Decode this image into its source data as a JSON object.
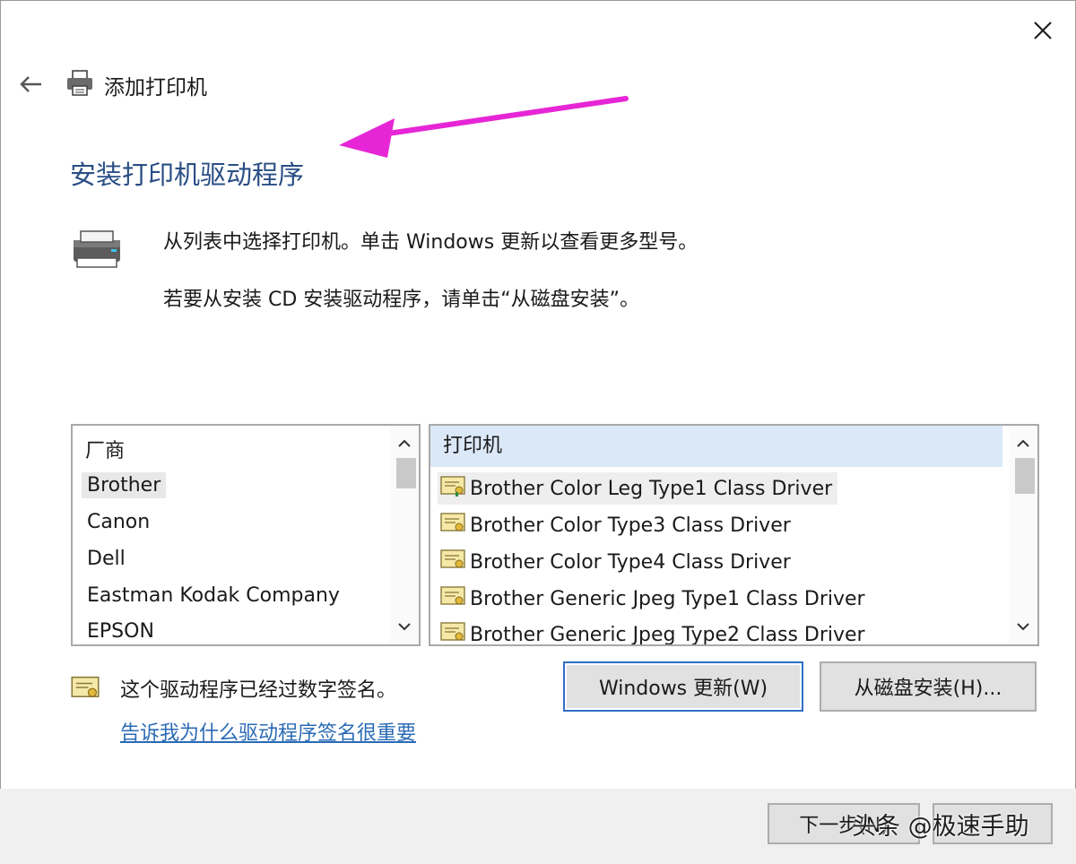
{
  "window": {
    "title": "添加打印机"
  },
  "heading": "安装打印机驱动程序",
  "description": {
    "line1": "从列表中选择打印机。单击 Windows 更新以查看更多型号。",
    "line2": "若要从安装 CD 安装驱动程序，请单击“从磁盘安装”。"
  },
  "manufacturers": {
    "header": "厂商",
    "items": [
      {
        "label": "Brother",
        "selected": true
      },
      {
        "label": "Canon",
        "selected": false
      },
      {
        "label": "Dell",
        "selected": false
      },
      {
        "label": "Eastman Kodak Company",
        "selected": false
      },
      {
        "label": "EPSON",
        "selected": false
      }
    ]
  },
  "printers": {
    "header": "打印机",
    "items": [
      {
        "label": "Brother Color Leg Type1 Class Driver",
        "selected": true
      },
      {
        "label": "Brother Color Type3 Class Driver",
        "selected": false
      },
      {
        "label": "Brother Color Type4 Class Driver",
        "selected": false
      },
      {
        "label": "Brother Generic Jpeg Type1 Class Driver",
        "selected": false
      },
      {
        "label": "Brother Generic Jpeg Type2 Class Driver",
        "selected": false
      }
    ]
  },
  "signature": {
    "text": "这个驱动程序已经过数字签名。",
    "link": "告诉我为什么驱动程序签名很重要"
  },
  "buttons": {
    "windows_update": "Windows 更新(W)",
    "have_disk": "从磁盘安装(H)...",
    "next": "下一步(N)",
    "cancel": ""
  },
  "watermark": "头条 @极速手助",
  "icons": {
    "close": "close-icon",
    "back": "back-arrow-icon",
    "printer": "printer-icon",
    "driver": "driver-certificate-icon",
    "annotation": "annotation-arrow"
  },
  "colors": {
    "heading": "#2a4e85",
    "link": "#2a6bb5",
    "annotation_arrow": "#e626d6",
    "list_header_bg": "#dbe8f7",
    "focus_border": "#2f6ec4"
  }
}
